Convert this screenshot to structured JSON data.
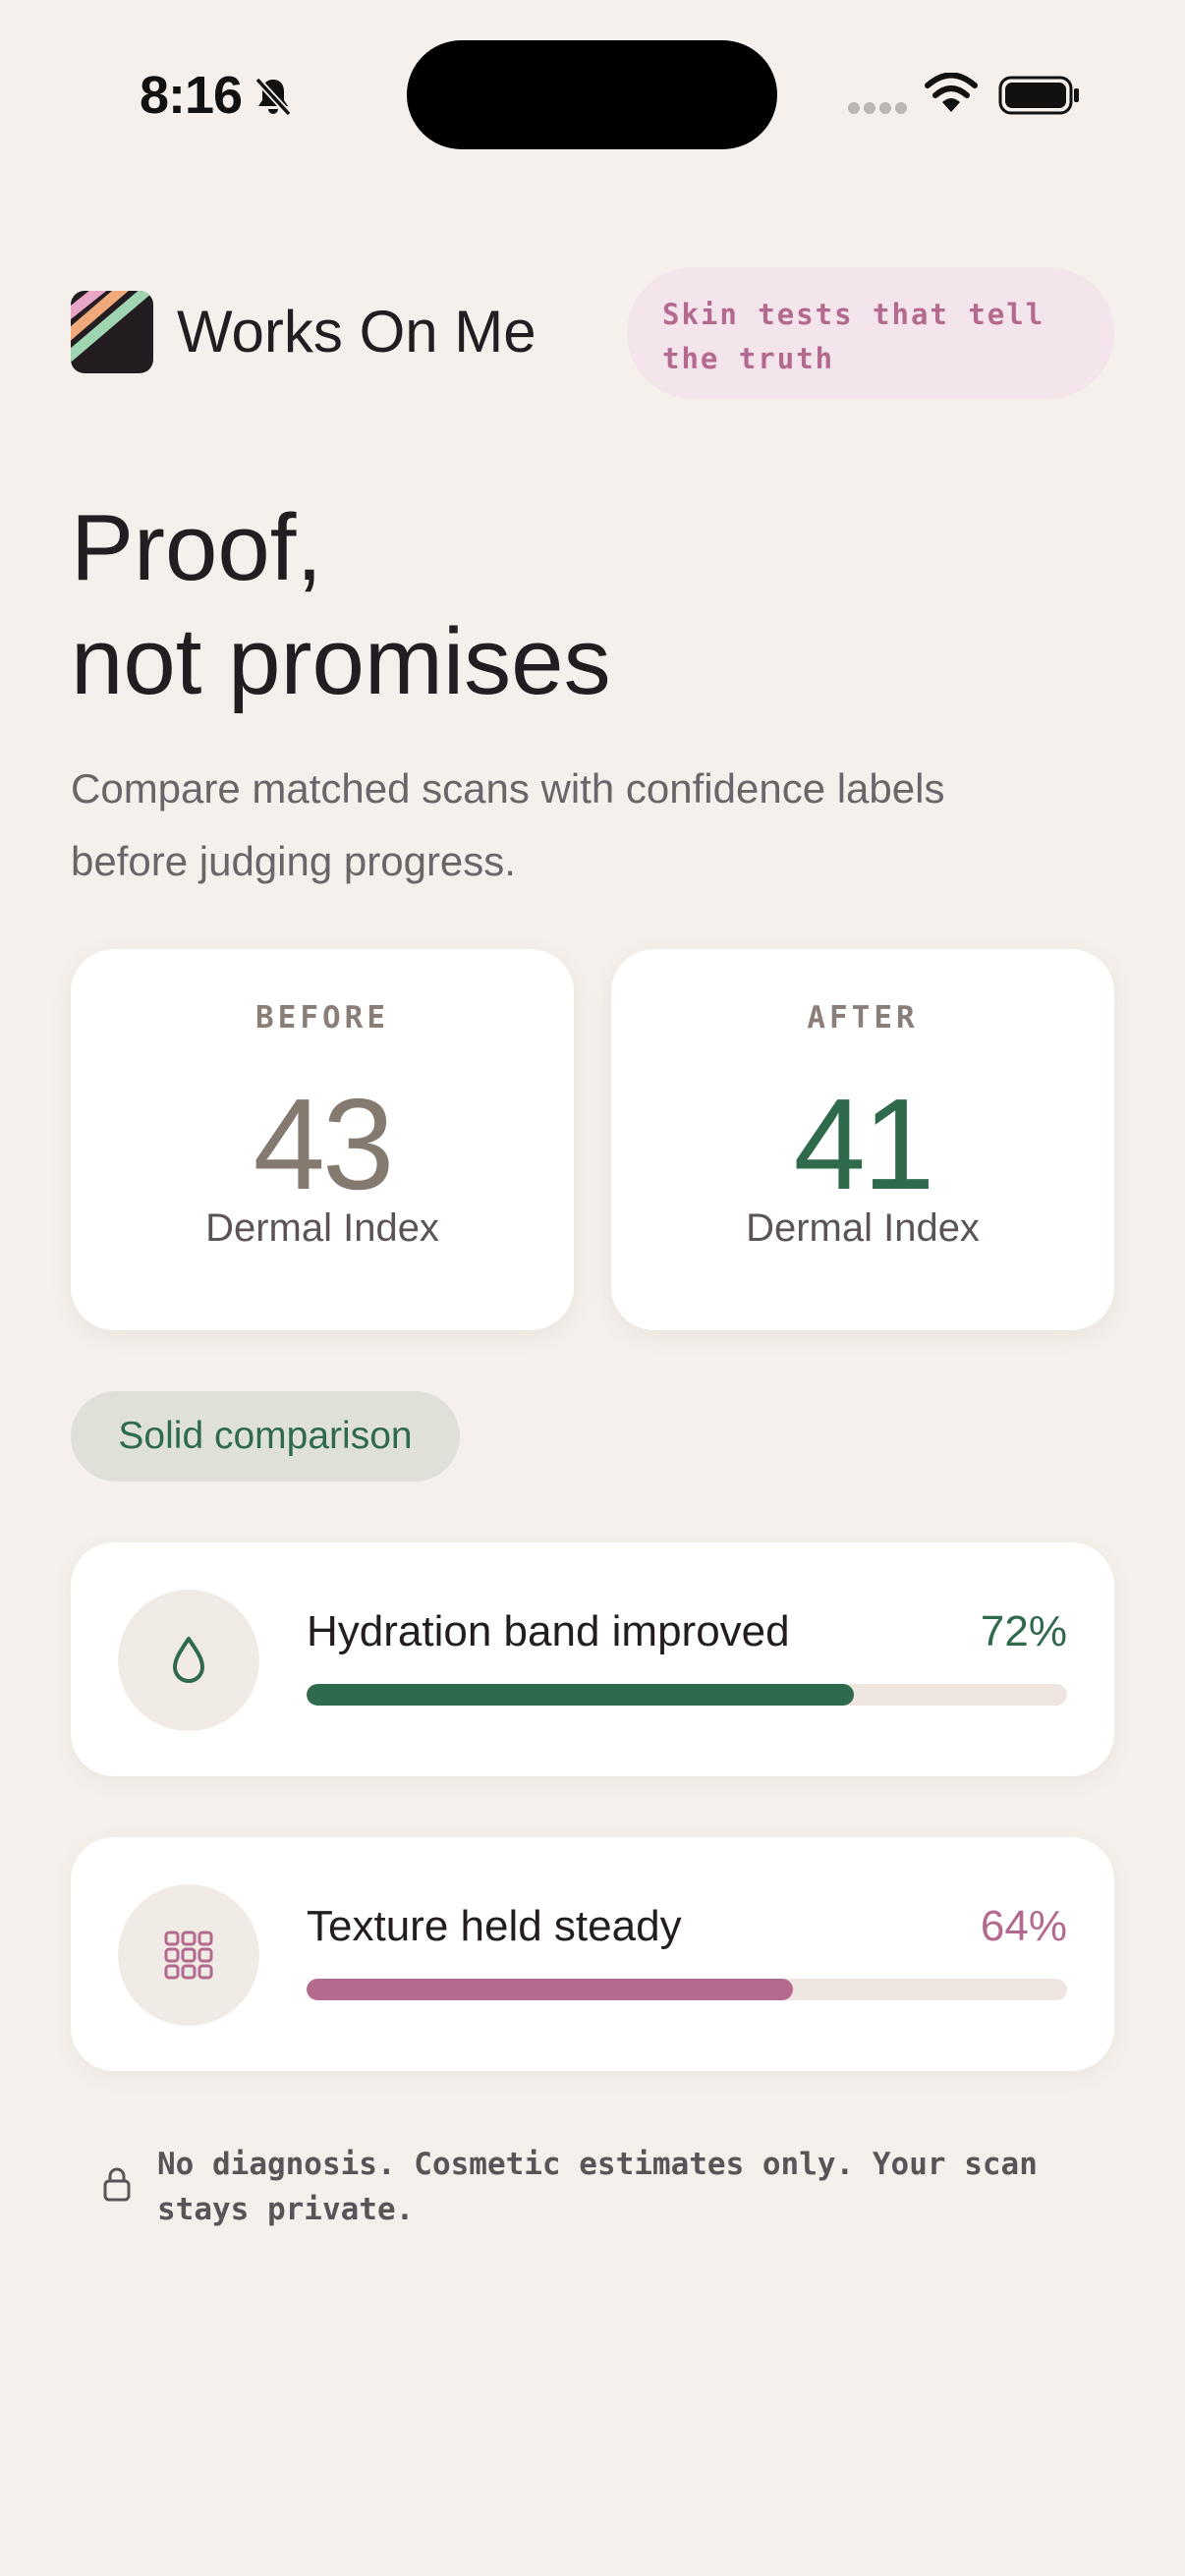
{
  "status_bar": {
    "time": "8:16"
  },
  "header": {
    "brand": "Works On Me",
    "tagline": "Skin tests that tell the truth"
  },
  "hero": {
    "title_line1": "Proof,",
    "title_line2": "not promises",
    "subtitle": "Compare matched scans with confidence labels before judging progress."
  },
  "scores": {
    "before": {
      "label": "BEFORE",
      "value": "43",
      "unit": "Dermal Index"
    },
    "after": {
      "label": "AFTER",
      "value": "41",
      "unit": "Dermal Index"
    }
  },
  "confidence_pill": "Solid comparison",
  "metrics": [
    {
      "icon": "droplet-icon",
      "label": "Hydration band improved",
      "value_text": "72%",
      "value": 72,
      "color": "#2f6a4d"
    },
    {
      "icon": "grid-icon",
      "label": "Texture held steady",
      "value_text": "64%",
      "value": 64,
      "color": "#b36a8e"
    }
  ],
  "footer": {
    "icon": "lock-icon",
    "note": "No diagnosis. Cosmetic estimates only. Your scan stays private."
  },
  "colors": {
    "background": "#f5f0eb",
    "green_accent": "#2f6a4d",
    "pink_accent": "#b36a8e",
    "tagline_bg": "#f4e4ec",
    "pill_bg": "#dfe1d9"
  }
}
